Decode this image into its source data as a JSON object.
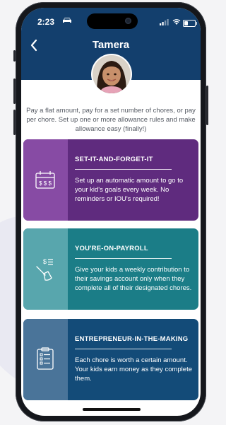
{
  "status_bar": {
    "time": "2:23",
    "car_icon": "car-icon",
    "signal_icon": "signal-icon",
    "wifi_icon": "wifi-icon",
    "battery_icon": "battery-icon"
  },
  "header": {
    "title": "Tamera",
    "back_icon": "chevron-left-icon",
    "background": "#133f6d"
  },
  "intro_text": "Pay a flat amount, pay for a set number of chores, or pay per chore. Set up one or more allowance rules and make allowance easy (finally!)",
  "cards": [
    {
      "title": "SET-IT-AND-FORGET-IT",
      "description": "Set up an automatic amount to go to your kid's goals every week. No reminders or IOU's required!",
      "icon": "calendar-dollar-icon",
      "color": "#5f2b7e",
      "icon_bg": "#874ba4"
    },
    {
      "title": "YOU'RE-ON-PAYROLL",
      "description": "Give your kids a weekly contribution to their savings account only when they complete all of their designated chores.",
      "icon": "cleaning-broom-icon",
      "color": "#1b7d87",
      "icon_bg": "#58a6ad"
    },
    {
      "title": "ENTREPRENEUR-IN-THE-MAKING",
      "description": "Each chore is worth a certain amount. Your kids earn money as they complete them.",
      "icon": "checklist-icon",
      "color": "#134b78",
      "icon_bg": "#4a7499"
    }
  ]
}
